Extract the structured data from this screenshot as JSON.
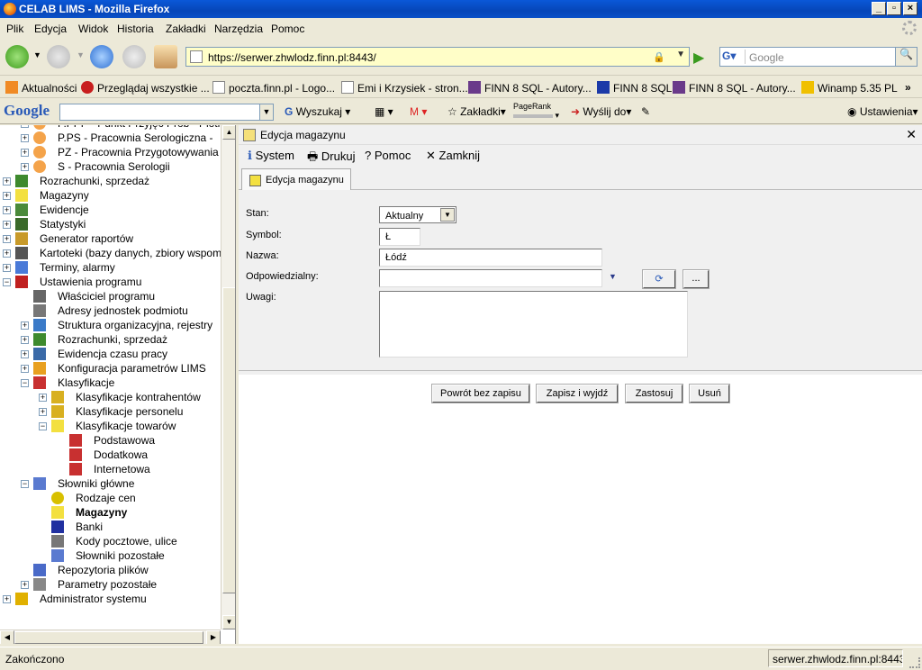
{
  "window": {
    "title": "CELAB LIMS - Mozilla Firefox"
  },
  "menu": [
    "Plik",
    "Edycja",
    "Widok",
    "Historia",
    "Zakładki",
    "Narzędzia",
    "Pomoc"
  ],
  "nav": {
    "url": "https://serwer.zhwlodz.finn.pl:8443/",
    "search_placeholder": "Google"
  },
  "bookmarks": [
    "Aktualności",
    "Przeglądaj wszystkie ...",
    "poczta.finn.pl - Logo...",
    "Emi i Krzysiek - stron...",
    "FINN 8 SQL - Autory...",
    "FINN 8 SQL",
    "FINN 8 SQL - Autory...",
    "Winamp 5.35 PL"
  ],
  "google_toolbar": {
    "logo": "Google",
    "search": "Wyszukaj",
    "bookmarks": "Zakładki",
    "pagerank": "PageRank",
    "send": "Wyślij do",
    "settings": "Ustawienia"
  },
  "tree": [
    {
      "label": "P.PPP - Punkt Przyjęć Prób - Piotr",
      "level": 2,
      "icon": "orange"
    },
    {
      "label": "P.PS - Pracownia Serologiczna -",
      "level": 2,
      "icon": "orange"
    },
    {
      "label": "PZ - Pracownia Przygotowywania",
      "level": 2,
      "icon": "orange"
    },
    {
      "label": "S - Pracownia Serologii",
      "level": 2,
      "icon": "orange"
    },
    {
      "label": "Rozrachunki, sprzedaż",
      "level": 1,
      "icon": "money"
    },
    {
      "label": "Magazyny",
      "level": 1,
      "icon": "box"
    },
    {
      "label": "Ewidencje",
      "level": 1,
      "icon": "sheet"
    },
    {
      "label": "Statystyki",
      "level": 1,
      "icon": "chart"
    },
    {
      "label": "Generator raportów",
      "level": 1,
      "icon": "gen"
    },
    {
      "label": "Kartoteki (bazy danych, zbiory wspom",
      "level": 1,
      "icon": "files"
    },
    {
      "label": "Terminy, alarmy",
      "level": 1,
      "icon": "pen"
    },
    {
      "label": "Ustawienia programu",
      "level": 1,
      "icon": "tools",
      "expanded": true
    },
    {
      "label": "Właściciel programu",
      "level": 2,
      "icon": "owner",
      "leaf": true
    },
    {
      "label": "Adresy jednostek podmiotu",
      "level": 2,
      "icon": "addr",
      "leaf": true
    },
    {
      "label": "Struktura organizacyjna, rejestry",
      "level": 2,
      "icon": "org"
    },
    {
      "label": "Rozrachunki, sprzedaż",
      "level": 2,
      "icon": "money"
    },
    {
      "label": "Ewidencja czasu pracy",
      "level": 2,
      "icon": "time"
    },
    {
      "label": "Konfiguracja parametrów LIMS",
      "level": 2,
      "icon": "flask"
    },
    {
      "label": "Klasyfikacje",
      "level": 2,
      "icon": "class",
      "expanded": true
    },
    {
      "label": "Klasyfikacje kontrahentów",
      "level": 3,
      "icon": "person"
    },
    {
      "label": "Klasyfikacje personelu",
      "level": 3,
      "icon": "person"
    },
    {
      "label": "Klasyfikacje towarów",
      "level": 3,
      "icon": "box",
      "expanded": true
    },
    {
      "label": "Podstawowa",
      "level": 4,
      "icon": "class",
      "leaf": true
    },
    {
      "label": "Dodatkowa",
      "level": 4,
      "icon": "class",
      "leaf": true
    },
    {
      "label": "Internetowa",
      "level": 4,
      "icon": "class",
      "leaf": true
    },
    {
      "label": "Słowniki główne",
      "level": 2,
      "icon": "dict",
      "expanded": true
    },
    {
      "label": "Rodzaje cen",
      "level": 3,
      "icon": "coin",
      "leaf": true
    },
    {
      "label": "Magazyny",
      "level": 3,
      "icon": "box",
      "leaf": true,
      "bold": true
    },
    {
      "label": "Banki",
      "level": 3,
      "icon": "bank",
      "leaf": true
    },
    {
      "label": "Kody pocztowe, ulice",
      "level": 3,
      "icon": "addr",
      "leaf": true
    },
    {
      "label": "Słowniki pozostałe",
      "level": 3,
      "icon": "dict",
      "leaf": true
    },
    {
      "label": "Repozytoria plików",
      "level": 2,
      "icon": "repo",
      "leaf": true
    },
    {
      "label": "Parametry pozostałe",
      "level": 2,
      "icon": "params"
    },
    {
      "label": "Administrator systemu",
      "level": 1,
      "icon": "key"
    }
  ],
  "dialog": {
    "title": "Edycja magazynu",
    "toolbar": {
      "system": "System",
      "print": "Drukuj",
      "help": "Pomoc",
      "close": "Zamknij"
    },
    "tab": "Edycja magazynu",
    "labels": {
      "stan": "Stan:",
      "symbol": "Symbol:",
      "nazwa": "Nazwa:",
      "odp": "Odpowiedzialny:",
      "uwagi": "Uwagi:"
    },
    "values": {
      "stan": "Aktualny",
      "symbol": "Ł",
      "nazwa": "Łódź",
      "odp": "",
      "uwagi": ""
    },
    "buttons": {
      "back": "Powrót bez zapisu",
      "save_exit": "Zapisz i wyjdź",
      "apply": "Zastosuj",
      "delete": "Usuń",
      "more": "..."
    }
  },
  "status": {
    "left": "Zakończono",
    "right": "serwer.zhwlodz.finn.pl:8443"
  }
}
